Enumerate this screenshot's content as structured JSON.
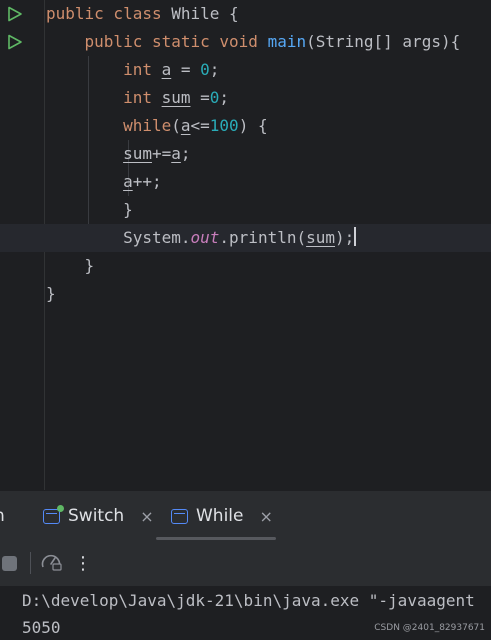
{
  "editor": {
    "code_lines": [
      {
        "tokens": [
          {
            "t": "public class ",
            "c": "kw"
          },
          {
            "t": "While {",
            "c": ""
          }
        ]
      },
      {
        "tokens": [
          {
            "t": "    public static void ",
            "c": "kw"
          },
          {
            "t": "main",
            "c": "fn"
          },
          {
            "t": "(String[] args){",
            "c": ""
          }
        ]
      },
      {
        "tokens": [
          {
            "t": "        int ",
            "c": "kw"
          },
          {
            "t": "a",
            "c": "ul"
          },
          {
            "t": " = ",
            "c": ""
          },
          {
            "t": "0",
            "c": "num"
          },
          {
            "t": ";",
            "c": ""
          }
        ]
      },
      {
        "tokens": [
          {
            "t": "        int ",
            "c": "kw"
          },
          {
            "t": "sum",
            "c": "ul"
          },
          {
            "t": " =",
            "c": ""
          },
          {
            "t": "0",
            "c": "num"
          },
          {
            "t": ";",
            "c": ""
          }
        ]
      },
      {
        "tokens": [
          {
            "t": "        while",
            "c": "kw"
          },
          {
            "t": "(",
            "c": ""
          },
          {
            "t": "a",
            "c": "ul"
          },
          {
            "t": "<=",
            "c": ""
          },
          {
            "t": "100",
            "c": "num"
          },
          {
            "t": ") {",
            "c": ""
          }
        ]
      },
      {
        "tokens": [
          {
            "t": "        ",
            "c": ""
          },
          {
            "t": "sum",
            "c": "ul"
          },
          {
            "t": "+=",
            "c": ""
          },
          {
            "t": "a",
            "c": "ul"
          },
          {
            "t": ";",
            "c": ""
          }
        ]
      },
      {
        "tokens": [
          {
            "t": "        ",
            "c": ""
          },
          {
            "t": "a",
            "c": "ul"
          },
          {
            "t": "++;",
            "c": ""
          }
        ]
      },
      {
        "tokens": [
          {
            "t": "        }",
            "c": ""
          }
        ]
      },
      {
        "tokens": [
          {
            "t": "        System.",
            "c": ""
          },
          {
            "t": "out",
            "c": "fld"
          },
          {
            "t": ".println(",
            "c": ""
          },
          {
            "t": "sum",
            "c": "ul"
          },
          {
            "t": ");",
            "c": ""
          }
        ]
      },
      {
        "tokens": [
          {
            "t": "    }",
            "c": ""
          }
        ]
      },
      {
        "tokens": [
          {
            "t": "}",
            "c": ""
          }
        ]
      }
    ],
    "current_line": 8,
    "run_gutter_icons": [
      "run-class-icon",
      "run-main-icon"
    ]
  },
  "run_window": {
    "partial_tab_label": "n",
    "tabs": [
      {
        "label": "Switch",
        "icon": "run-config-icon",
        "active": false,
        "close_label": "×"
      },
      {
        "label": "While",
        "icon": "run-config-icon",
        "active": true,
        "close_label": "×"
      }
    ],
    "toolbar": {
      "stop_icon": "stop-icon",
      "profiler_icon": "speedometer-icon",
      "more_label": "⋮"
    },
    "console": {
      "command_line": "D:\\develop\\Java\\jdk-21\\bin\\java.exe \"-javaagent",
      "output": "5050"
    }
  },
  "watermark": "CSDN @2401_82937671",
  "colors": {
    "background": "#1e1f22",
    "keyword": "#cf8e6d",
    "number": "#2aacb8",
    "method": "#56a8f5",
    "static_field": "#c77dbb",
    "run_green": "#5fb865"
  }
}
